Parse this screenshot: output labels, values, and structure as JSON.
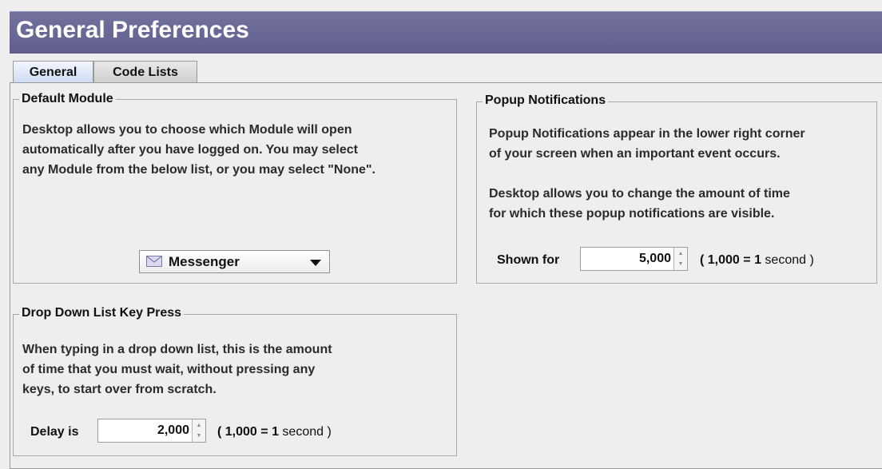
{
  "window": {
    "title": "General Preferences"
  },
  "tabs": [
    {
      "label": "General",
      "active": true
    },
    {
      "label": "Code Lists",
      "active": false
    }
  ],
  "default_module": {
    "title": "Default Module",
    "description": "Desktop allows you to choose which Module will open\nautomatically after you have logged on.  You may select\nany Module from the below list, or you may select \"None\".",
    "selected": "Messenger",
    "selected_icon": "envelope-icon"
  },
  "popup_notifications": {
    "title": "Popup Notifications",
    "description": "Popup Notifications appear in the lower right corner\nof your screen when an important event occurs.\n\nDesktop allows you to change the amount of time\nfor which these popup notifications are visible.",
    "shown_for_label": "Shown for",
    "shown_for_value": "5,000",
    "hint_prefix": "( 1,000 =",
    "hint_number": "1",
    "hint_suffix": "second )"
  },
  "drop_down_key_press": {
    "title": "Drop Down List Key Press",
    "description": "When typing in a drop down list, this is the amount\nof time that you must wait, without pressing any\nkeys, to start over from scratch.",
    "delay_label": "Delay is",
    "delay_value": "2,000",
    "hint_prefix": "( 1,000 =",
    "hint_number": "1",
    "hint_suffix": "second )"
  }
}
